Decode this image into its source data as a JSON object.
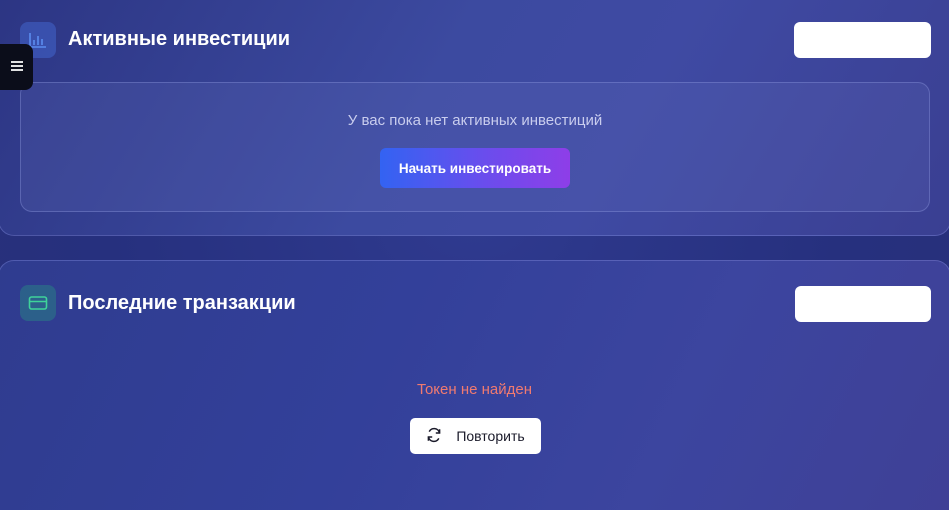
{
  "investments": {
    "title": "Активные инвестиции",
    "icon": "bar-chart-icon",
    "empty_message": "У вас пока нет активных инвестиций",
    "cta_label": "Начать инвестировать"
  },
  "transactions": {
    "title": "Последние транзакции",
    "icon": "credit-card-icon",
    "error_message": "Токен не найден",
    "retry_label": "Повторить",
    "retry_icon": "refresh-icon"
  },
  "menu": {
    "icon": "hamburger-icon"
  },
  "colors": {
    "accent_start": "#3363f2",
    "accent_end": "#8e3ee8",
    "error": "#f07a70",
    "icon_blue": "#5b8cf0",
    "icon_green": "#3fd39a"
  }
}
